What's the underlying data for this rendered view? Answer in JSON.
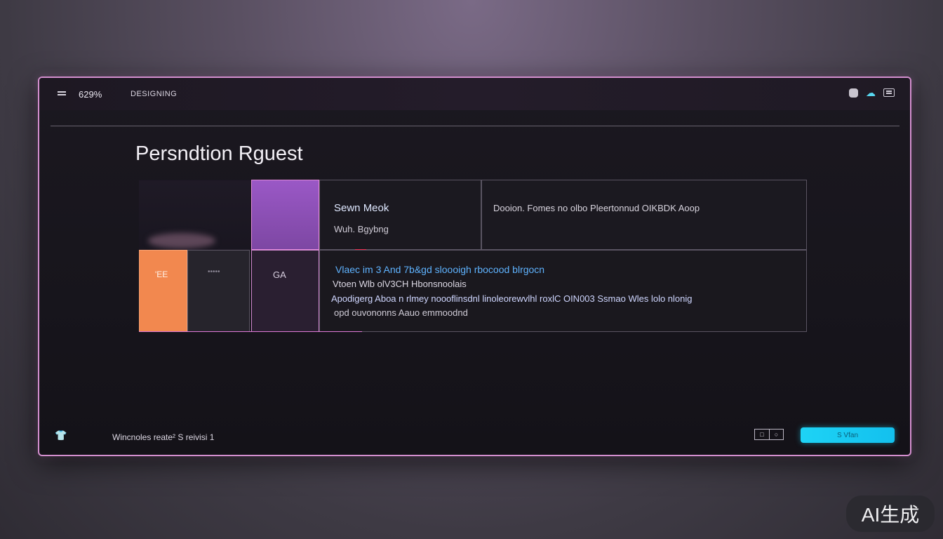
{
  "topbar": {
    "zoom": "629%",
    "menu_title": "DESIGNING",
    "icons": [
      "menu-icon",
      "database-icon",
      "cloud-icon",
      "grid-icon"
    ]
  },
  "page": {
    "title": "Persndtion Rguest"
  },
  "table": {
    "header": {
      "primary": "Sewn Meok",
      "secondary": "Wuh. Bgybng",
      "description": "Dooion. Fomes no olbo Pleertonnud OIKBDK Aoop"
    },
    "row": {
      "orange_label": "'EE",
      "grey_label": "•••••",
      "mauve_label": "GA",
      "line1": "Vlaec im 3 And 7b&gd sloooigh rbocood blrgocn",
      "line2": "Vtoen Wlb olV3CH Hbonsnoolais",
      "line3": "Apodigerg Aboa n rlmey noooflinsdnl linoleorewvlhl roxlC OIN003  Ssmao Wles lolo nlonig",
      "line4": "opd ouvononns Aauo emmoodnd"
    }
  },
  "footer": {
    "status_text": "Wincnoles   reate² S reivisi 1",
    "page_prev": "□",
    "page_next": "○",
    "cta_label": "S Vfan"
  },
  "watermark": "AI生成",
  "colors": {
    "accent_pink": "#d48fcf",
    "accent_purple": "#9a58c6",
    "accent_orange": "#f2884f",
    "accent_cyan": "#1ed3f5",
    "link_blue": "#5fb3ff",
    "error_red": "#e8294a"
  }
}
